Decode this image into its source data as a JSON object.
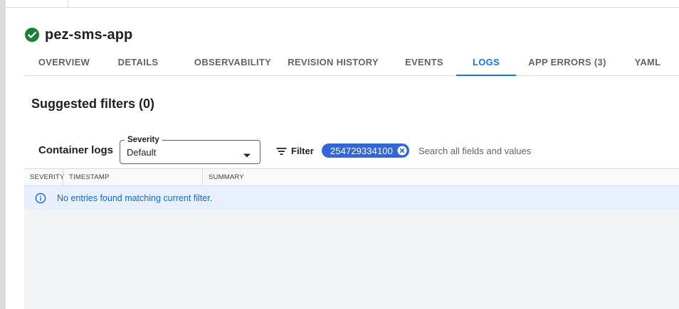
{
  "header": {
    "app_name": "pez-sms-app",
    "status": "healthy"
  },
  "tabs": [
    {
      "label": "OVERVIEW",
      "active": false
    },
    {
      "label": "DETAILS",
      "active": false
    },
    {
      "label": "OBSERVABILITY",
      "active": false
    },
    {
      "label": "REVISION HISTORY",
      "active": false
    },
    {
      "label": "EVENTS",
      "active": false
    },
    {
      "label": "LOGS",
      "active": true
    },
    {
      "label": "APP ERRORS (3)",
      "active": false
    },
    {
      "label": "YAML",
      "active": false
    }
  ],
  "suggested_filters": {
    "title": "Suggested filters (0)"
  },
  "logs": {
    "container_logs_label": "Container logs",
    "severity": {
      "label": "Severity",
      "value": "Default"
    },
    "filter_label": "Filter",
    "chip_text": "254729334100",
    "search_placeholder": "Search all fields and values",
    "columns": [
      "SEVERITY",
      "TIMESTAMP",
      "SUMMARY"
    ],
    "empty_message": "No entries found matching current filter."
  },
  "colors": {
    "accent": "#1a73e8",
    "chip": "#3367d6",
    "status_ok": "#188038",
    "info_bg": "#e8f0fe"
  },
  "icons": {
    "status": "check-circle-icon",
    "dropdown": "caret-down-icon",
    "filter": "filter-list-icon",
    "chip_close": "cancel-icon",
    "info": "info-icon"
  }
}
